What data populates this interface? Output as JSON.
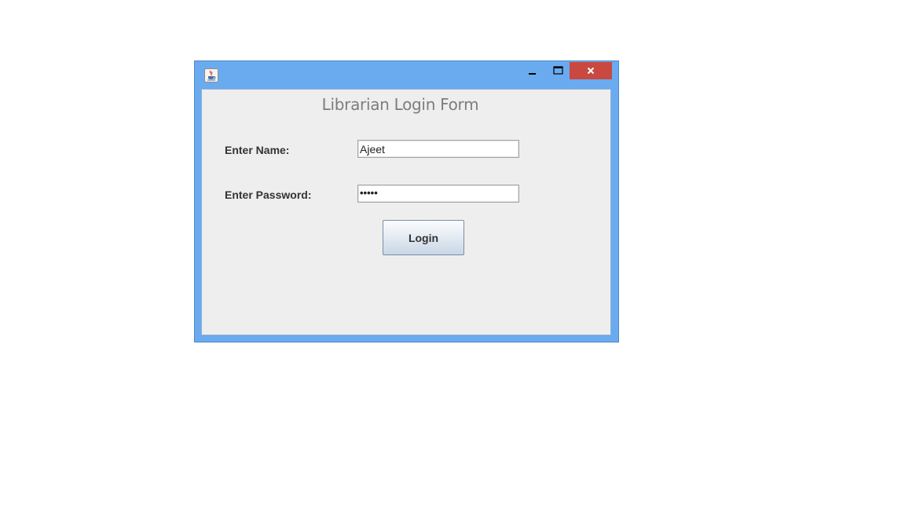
{
  "window": {
    "icon": "java-cup-icon",
    "controls": {
      "minimize": "minimize-icon",
      "maximize": "maximize-icon",
      "close": "close-icon"
    },
    "close_color": "#c9483f",
    "frame_color": "#6aabf0"
  },
  "form": {
    "title": "Librarian Login Form",
    "name_label": "Enter Name:",
    "name_value": "Ajeet",
    "password_label": "Enter Password:",
    "password_mask": "•••••",
    "login_label": "Login"
  }
}
